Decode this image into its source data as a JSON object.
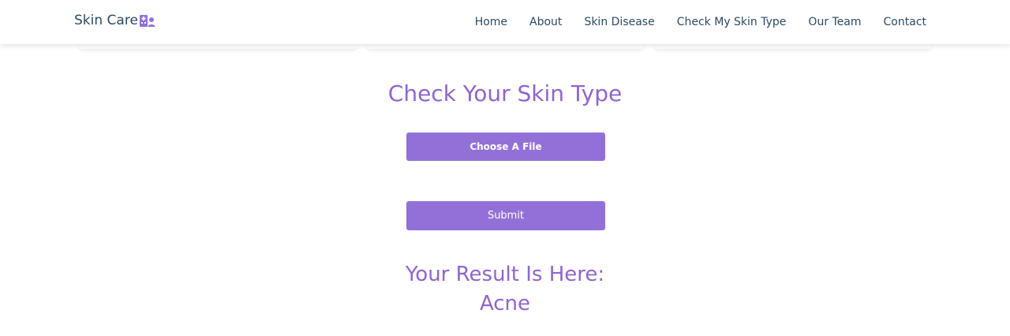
{
  "navbar": {
    "brand": "Skin Care",
    "brand_icon": "hospital-user-icon",
    "links": [
      "Home",
      "About",
      "Skin Disease",
      "Check My Skin Type",
      "Our Team",
      "Contact"
    ]
  },
  "colors": {
    "accent": "#9370d8",
    "heading": "#9164cf",
    "nav_text": "#2c4964"
  },
  "upload": {
    "title": "Check Your Skin Type",
    "file_button_label": "Choose A File",
    "submit_label": "Submit"
  },
  "result": {
    "heading": "Your Result Is Here:",
    "value": "Acne"
  }
}
